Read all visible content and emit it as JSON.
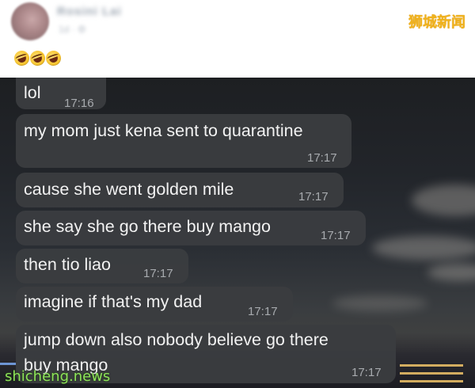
{
  "post": {
    "poster_name": "Rosini Lai",
    "poster_meta": "1d · ⚙",
    "source_label": "狮城新闻",
    "reaction_emojis": [
      "laughing-face-icon",
      "laughing-face-icon",
      "laughing-face-icon"
    ]
  },
  "chat": {
    "messages": [
      {
        "text": "lol",
        "time": "17:16"
      },
      {
        "text": "my mom just kena sent to quarantine",
        "time": "17:17"
      },
      {
        "text": "cause she went golden mile",
        "time": "17:17"
      },
      {
        "text": "she say she go there buy mango",
        "time": "17:17"
      },
      {
        "text": "then tio liao",
        "time": "17:17"
      },
      {
        "text": "imagine if that's my dad",
        "time": "17:17"
      },
      {
        "text": "jump down also nobody believe go there buy mango",
        "line1": "jump down also nobody believe go there",
        "line2": "buy mango",
        "time": "17:17"
      }
    ]
  },
  "watermark": "shicheng.news",
  "colors": {
    "bubble": "#3a3c40",
    "bubble_text": "#f2f2f2",
    "timestamp": "#a7aaae",
    "source_label": "#f0b21c",
    "watermark": "#8ee35a"
  }
}
